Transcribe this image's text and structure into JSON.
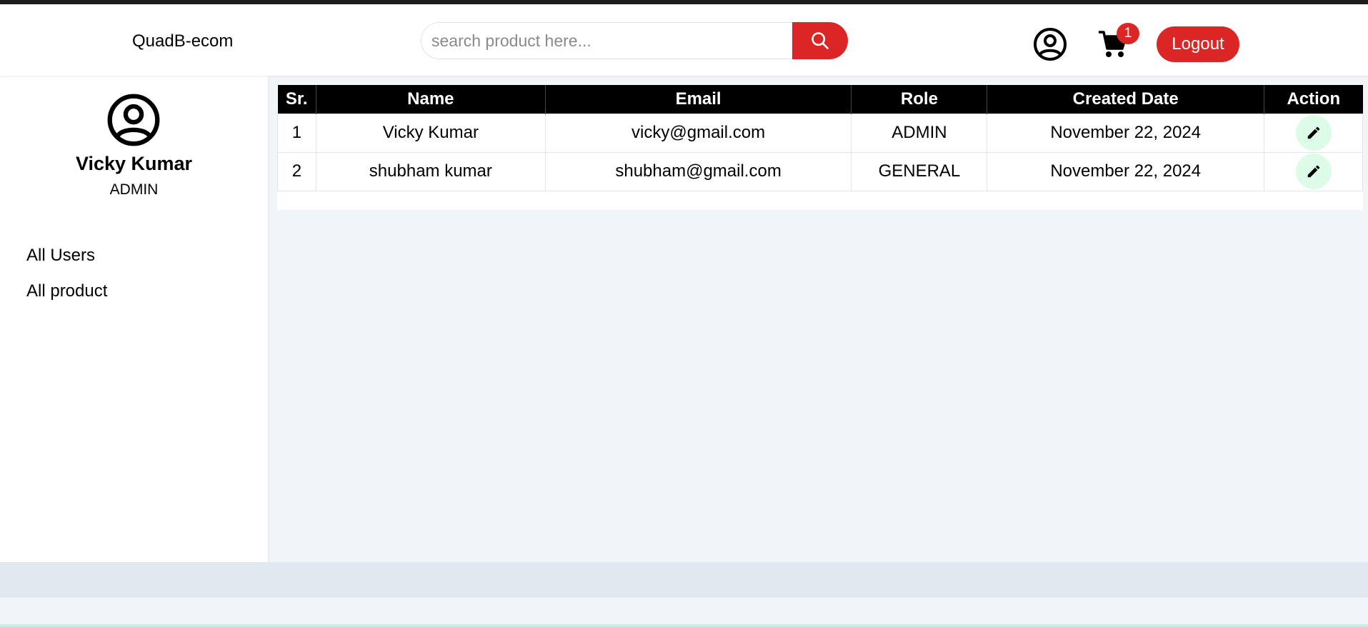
{
  "header": {
    "logo": "QuadB-ecom",
    "search_placeholder": "search product here...",
    "cart_count": "1",
    "logout_label": "Logout"
  },
  "sidebar": {
    "user_name": "Vicky Kumar",
    "user_role": "ADMIN",
    "items": [
      {
        "label": "All Users"
      },
      {
        "label": "All product"
      }
    ]
  },
  "table": {
    "columns": [
      "Sr.",
      "Name",
      "Email",
      "Role",
      "Created Date",
      "Action"
    ],
    "rows": [
      {
        "sr": "1",
        "name": "Vicky Kumar",
        "email": "vicky@gmail.com",
        "role": "ADMIN",
        "created": "November 22, 2024"
      },
      {
        "sr": "2",
        "name": "shubham kumar",
        "email": "shubham@gmail.com",
        "role": "GENERAL",
        "created": "November 22, 2024"
      }
    ]
  },
  "icons": {
    "search": "search-icon",
    "user": "user-circle-icon",
    "cart": "cart-icon",
    "edit": "pencil-icon"
  },
  "colors": {
    "accent": "#dc2626",
    "edit_bg": "#dcfce7",
    "header_row": "#000000"
  }
}
